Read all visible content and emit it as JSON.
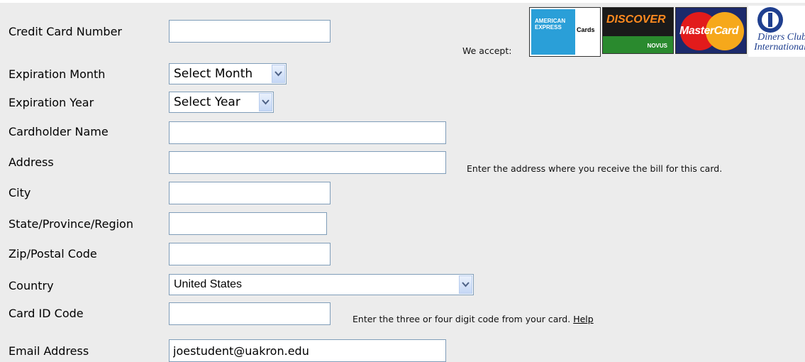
{
  "form": {
    "card_number": {
      "label": "Credit Card Number",
      "value": ""
    },
    "exp_month": {
      "label": "Expiration Month",
      "selected": "Select Month"
    },
    "exp_year": {
      "label": "Expiration Year",
      "selected": "Select Year"
    },
    "cardholder": {
      "label": "Cardholder Name",
      "value": ""
    },
    "address": {
      "label": "Address",
      "value": "",
      "hint": "Enter the address where you receive the bill for this card."
    },
    "city": {
      "label": "City",
      "value": ""
    },
    "state": {
      "label": "State/Province/Region",
      "value": ""
    },
    "zip": {
      "label": "Zip/Postal Code",
      "value": ""
    },
    "country": {
      "label": "Country",
      "selected": "United States"
    },
    "card_id": {
      "label": "Card ID Code",
      "value": "",
      "hint": "Enter the three or four digit code from your card.",
      "help_link": "Help"
    },
    "email": {
      "label": "Email Address",
      "value": "joestudent@uakron.edu"
    }
  },
  "accepted_cards": {
    "label": "We accept:",
    "amex_line1": "AMERICAN",
    "amex_line2": "EXPRESS",
    "amex_suffix": "Cards",
    "discover_name": "DISCOVER",
    "discover_sub": "NOVUS",
    "mastercard_name": "MasterCard",
    "diners_line1": "Diners Club",
    "diners_line2": "International"
  },
  "icons": [
    "chevron-down-icon",
    "amex-logo",
    "discover-logo",
    "mastercard-logo",
    "diners-club-logo"
  ]
}
